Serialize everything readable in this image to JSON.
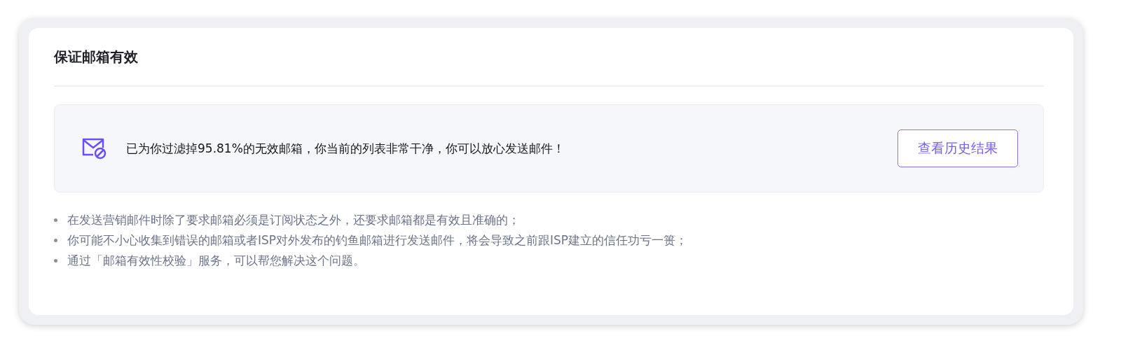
{
  "card": {
    "title": "保证邮箱有效"
  },
  "notice": {
    "message": "已为你过滤掉95.81%的无效邮箱，你当前的列表非常干净，你可以放心发送邮件！",
    "button": "查看历史结果"
  },
  "tips": [
    "在发送营销邮件时除了要求邮箱必须是订阅状态之外，还要求邮箱都是有效且准确的；",
    "你可能不小心收集到错误的邮箱或者ISP对外发布的钓鱼邮箱进行发送邮件，将会导致之前跟ISP建立的信任功亏一篑；",
    "通过「邮箱有效性校验」服务，可以帮您解决这个问题。"
  ]
}
